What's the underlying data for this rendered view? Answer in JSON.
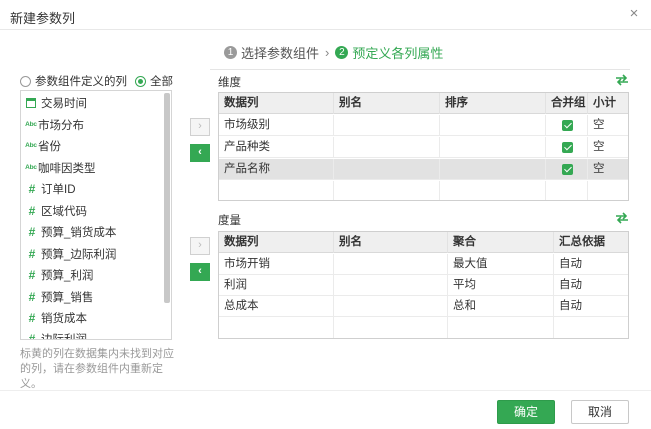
{
  "dialog": {
    "title": "新建参数列",
    "close_label": "×"
  },
  "steps": [
    {
      "num": "1",
      "label": "选择参数组件"
    },
    {
      "num": "2",
      "label": "预定义各列属性"
    }
  ],
  "steps_separator": "›",
  "source": {
    "options": [
      {
        "label": "参数组件定义的列",
        "selected": false
      },
      {
        "label": "全部",
        "selected": true
      }
    ],
    "fields": [
      {
        "label": "交易时间",
        "type": "date",
        "icon": "calendar-icon"
      },
      {
        "label": "市场分布",
        "type": "text",
        "icon": "abc-icon"
      },
      {
        "label": "省份",
        "type": "text",
        "icon": "abc-icon"
      },
      {
        "label": "咖啡因类型",
        "type": "text",
        "icon": "abc-icon"
      },
      {
        "label": "订单ID",
        "type": "number",
        "icon": "hash-icon"
      },
      {
        "label": "区域代码",
        "type": "number",
        "icon": "hash-icon"
      },
      {
        "label": "预算_销货成本",
        "type": "number",
        "icon": "hash-icon"
      },
      {
        "label": "预算_边际利润",
        "type": "number",
        "icon": "hash-icon"
      },
      {
        "label": "预算_利润",
        "type": "number",
        "icon": "hash-icon"
      },
      {
        "label": "预算_销售",
        "type": "number",
        "icon": "hash-icon"
      },
      {
        "label": "销货成本",
        "type": "number",
        "icon": "hash-icon"
      },
      {
        "label": "边际利润",
        "type": "number",
        "icon": "hash-icon"
      }
    ],
    "hint": "标黄的列在数据集内未找到对应的列，请在参数组件内重新定义。"
  },
  "icons": {
    "abc": "Abc",
    "hash": "#",
    "move_right": "›",
    "move_left": "‹"
  },
  "dimensions": {
    "label": "维度",
    "columns": [
      "数据列",
      "别名",
      "排序",
      "合并组",
      "小计"
    ],
    "rows": [
      {
        "field": "市场级别",
        "alias": "",
        "sort": "",
        "merge": true,
        "subtotal": "空",
        "selected": false
      },
      {
        "field": "产品种类",
        "alias": "",
        "sort": "",
        "merge": true,
        "subtotal": "空",
        "selected": false
      },
      {
        "field": "产品名称",
        "alias": "",
        "sort": "",
        "merge": true,
        "subtotal": "空",
        "selected": true
      }
    ]
  },
  "measures": {
    "label": "度量",
    "columns": [
      "数据列",
      "别名",
      "聚合",
      "汇总依据"
    ],
    "rows": [
      {
        "field": "市场开销",
        "alias": "",
        "agg": "最大值",
        "basis": "自动"
      },
      {
        "field": "利润",
        "alias": "",
        "agg": "平均",
        "basis": "自动"
      },
      {
        "field": "总成本",
        "alias": "",
        "agg": "总和",
        "basis": "自动"
      }
    ]
  },
  "footer": {
    "ok_label": "确定",
    "cancel_label": "取消"
  },
  "colors": {
    "accent": "#34a853",
    "header_bg": "#efefef",
    "selected_row": "#e2e2e2",
    "hint": "#999999"
  }
}
